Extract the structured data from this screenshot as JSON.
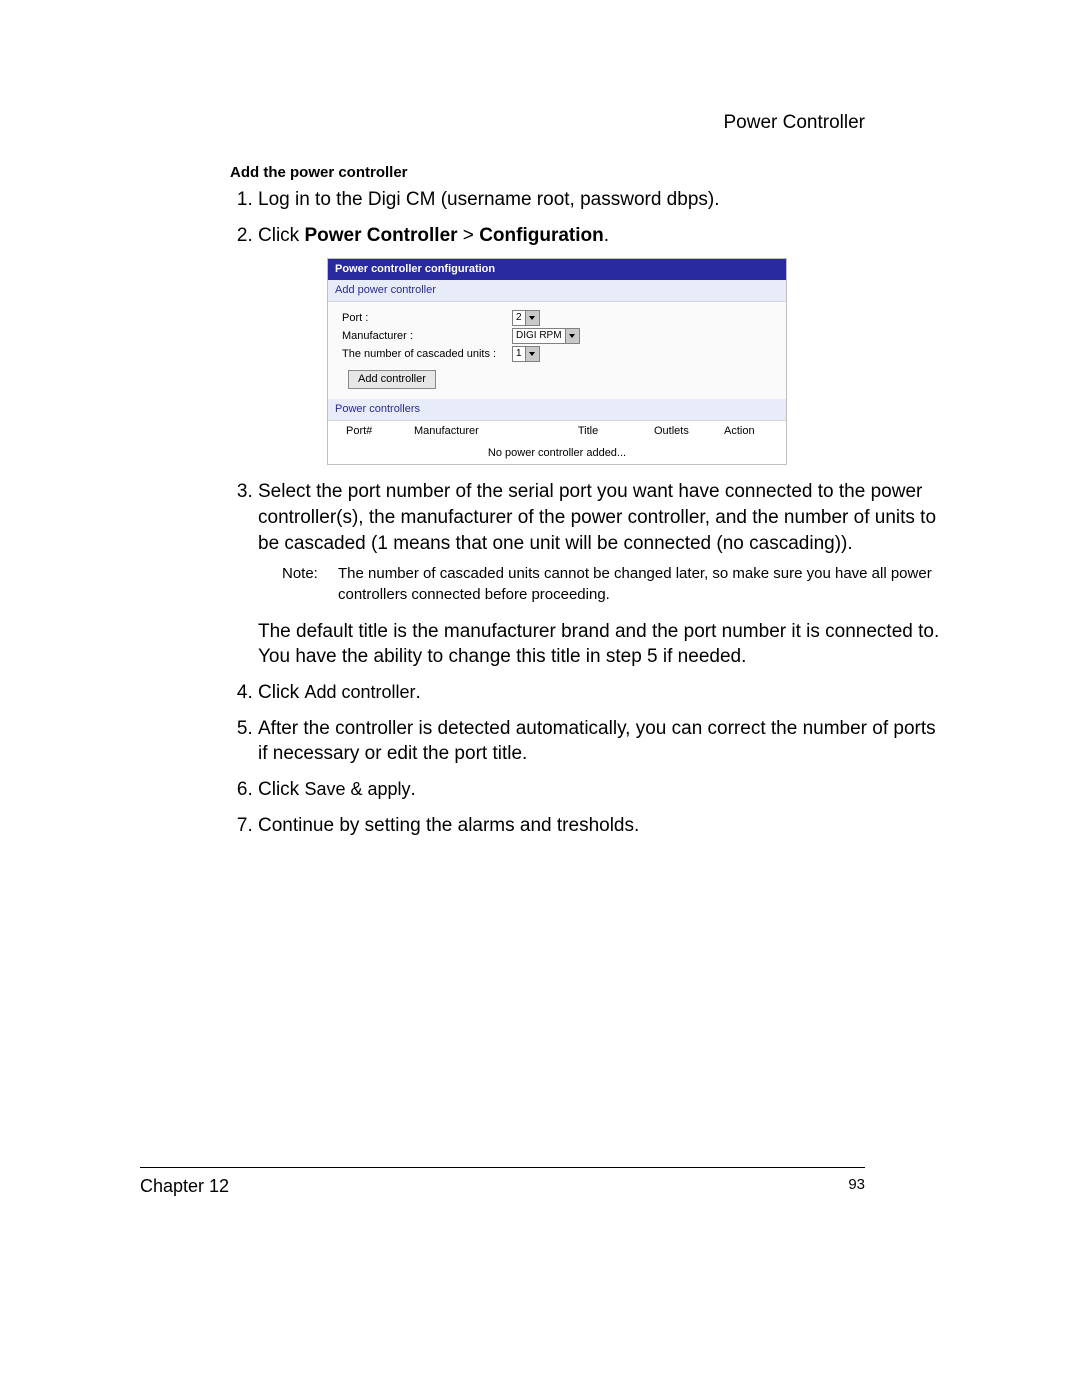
{
  "page_header": "Power Controller",
  "section_heading": "Add the power controller",
  "steps": {
    "s1": "Log in to the Digi CM (username root, password dbps).",
    "s2_a": "Click ",
    "s2_b": "Power Controller",
    "s2_c": " > ",
    "s2_d": "Configuration",
    "s2_e": ".",
    "s3": "Select the port number of the serial port you want have connected to the power controller(s), the manufacturer of the power controller, and the number of units to be cascaded (1 means that one unit will be connected (no cascading)).",
    "s3_note_label": "Note:",
    "s3_note": "The number of cascaded units cannot be changed later, so make sure you have all power controllers connected before proceeding.",
    "s3_para2": "The default title is the manufacturer brand and the port number it is connected to. You have the ability to change this title in step 5 if needed.",
    "s4_a": "Click ",
    "s4_b": "Add controller",
    "s4_c": ".",
    "s5": "After the controller is detected automatically, you can correct the number of ports if necessary or edit the port title.",
    "s6_a": "Click ",
    "s6_b": "Save & apply",
    "s6_c": ".",
    "s7": "Continue by setting the alarms and tresholds."
  },
  "screenshot": {
    "title": "Power controller configuration",
    "add_section": "Add power controller",
    "port_label": "Port :",
    "port_value": "2",
    "mfr_label": "Manufacturer :",
    "mfr_value": "DIGI RPM",
    "casc_label": "The number of cascaded units :",
    "casc_value": "1",
    "add_button": "Add controller",
    "list_section": "Power controllers",
    "th_port": "Port#",
    "th_mfr": "Manufacturer",
    "th_title": "Title",
    "th_outlets": "Outlets",
    "th_action": "Action",
    "empty": "No power controller added..."
  },
  "footer": {
    "chapter": "Chapter 12",
    "page": "93"
  }
}
